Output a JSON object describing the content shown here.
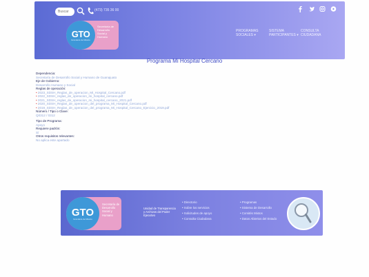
{
  "header": {
    "search_placeholder": "Buscar",
    "phone_text": "(473) 735 36 00",
    "logo": {
      "gto": "GTO",
      "sub": "Grandeza de México",
      "text": "Secretaría de Desarrollo Social y Humano"
    },
    "nav": [
      {
        "line1": "PROGRAMAS",
        "line2": "SOCIALES ▾"
      },
      {
        "line1": "SISTEMA",
        "line2": "PARTICIPANTES ▾"
      },
      {
        "line1": "CONSULTA",
        "line2": "CIUDADANA"
      }
    ]
  },
  "page_title": "Programa Mi Hospital Cercano",
  "content": {
    "dependencia_label": "Dependencia:",
    "dependencia_value": "Secretaría de Desarrollo Social y Humano de Guanajuato",
    "eje_label": "Eje de Gobierno:",
    "eje_value": "Desarrollo Humano y Social",
    "reglas_label": "Reglas de operación:",
    "reglas_items": [
      "2023_SDSH_Reglas_de_operacion_Mi_Hospital_Cercano.pdf",
      "2022_SDSH_reglas_de_operacion_mi_hospital_cercano.pdf",
      "2021_SDSH_reglas_de_operacion_mi_hospital_cercano_2021.pdf",
      "2020_SDSH_Reglas_de_operacion_del_programa_Mi_Hospital_Cercano.pdf",
      "2019_SDSH_Reglas_de_operacion_del_programa_Mi_Hospital_Cercano_Ejercicio_2019.pdf"
    ],
    "numero_label": "Número / Tipo o Clave:",
    "numero_value": "Q0312 / 0312",
    "tipo_label": "Tipo de Programa:",
    "tipo_value": "Apoyo",
    "req_label": "Requiere padrón:",
    "req_value": "Sí",
    "otros_label": "Otros requisitos relevantes:",
    "otros_value": "No aplica este apartado"
  },
  "footer": {
    "logo": {
      "gto": "GTO",
      "sub": "Grandeza de México",
      "text": "Secretaría de Desarrollo Social y Humano"
    },
    "unit": "Unidad de Transparencia y Archivos del Poder Ejecutivo",
    "col1": [
      "Directorio",
      "Sobre los servicios",
      "Solicitudes de apoyo",
      "Consulta Ciudadana"
    ],
    "col2": [
      "Programas",
      "Sistema de Desarrollo",
      "Comités Mixtos",
      "Datos Abiertos del Estado"
    ]
  }
}
